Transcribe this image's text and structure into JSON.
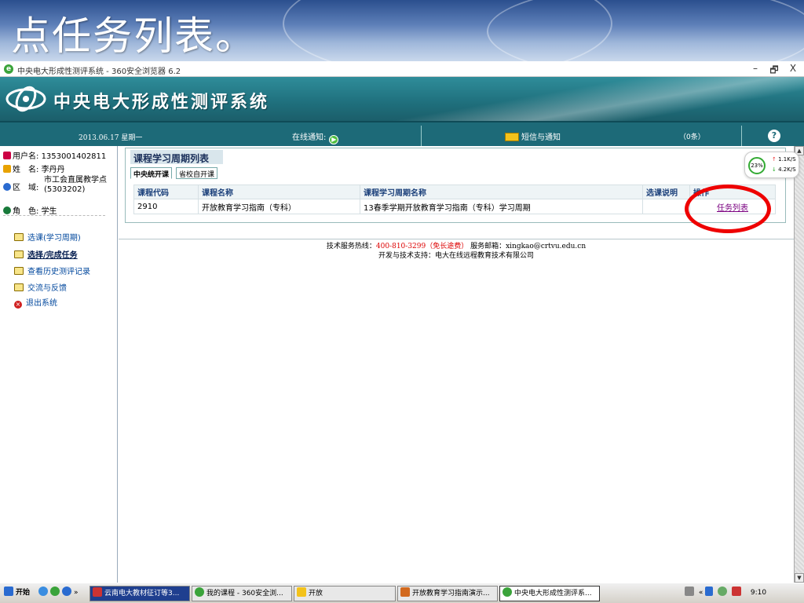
{
  "slide": {
    "title": "点任务列表。"
  },
  "window": {
    "title": "中央电大形成性测评系统 - 360安全浏览器 6.2",
    "minimize": "–",
    "restore": "🗗",
    "close": "X"
  },
  "banner": {
    "site_name": "中央电大形成性测评系统"
  },
  "navbar": {
    "date": "2013.06.17 星期一",
    "online_notice": "在线通知:",
    "sms_notice": "短信与通知",
    "count": "（0条）",
    "help": "?"
  },
  "user": {
    "username_label": "用户名:",
    "username": "1353001402811",
    "name_label": "姓　名:",
    "name": "李丹丹",
    "region_label": "区　域:",
    "region": "市工会直属教学点(5303202)",
    "role_label": "角　色:",
    "role": "学生"
  },
  "menu": [
    {
      "label": "选课(学习周期)",
      "icon": "book-icon"
    },
    {
      "label": "选择/完成任务",
      "icon": "book-icon"
    },
    {
      "label": "查看历史测评记录",
      "icon": "book-icon"
    },
    {
      "label": "交流与反馈",
      "icon": "book-icon"
    },
    {
      "label": "退出系统",
      "icon": "exit-icon"
    }
  ],
  "panel": {
    "title": "课程学习周期列表",
    "tabs": [
      {
        "label": "中央统开课"
      },
      {
        "label": "省校自开课"
      }
    ],
    "columns": [
      "课程代码",
      "课程名称",
      "课程学习周期名称",
      "选课说明",
      "操作"
    ],
    "rows": [
      {
        "code": "2910",
        "course": "开放教育学习指南（专科）",
        "period": "13春季学期开放教育学习指南（专科）学习周期",
        "note": "",
        "action": "任务列表"
      }
    ]
  },
  "footer": {
    "line1_prefix": "技术服务热线：",
    "hotline": "400-810-3299（免长途费）",
    "line1_suffix": " 服务邮箱：xingkao@crtvu.edu.cn",
    "line2": "开发与技术支持：电大在线远程教育技术有限公司"
  },
  "speed": {
    "percent": "23%",
    "up": "1.1K/S",
    "down": "4.2K/S"
  },
  "taskbar": {
    "start": "开始",
    "items": [
      "云南电大教材征订等3...",
      "我的课程 - 360安全浏...",
      "开放",
      "开放教育学习指南演示...",
      "中央电大形成性测评系..."
    ],
    "clock": "9:10"
  },
  "colors": {
    "banner": "#1f6f7c",
    "highlight_circle": "#e00000",
    "link": "#7a0080"
  }
}
